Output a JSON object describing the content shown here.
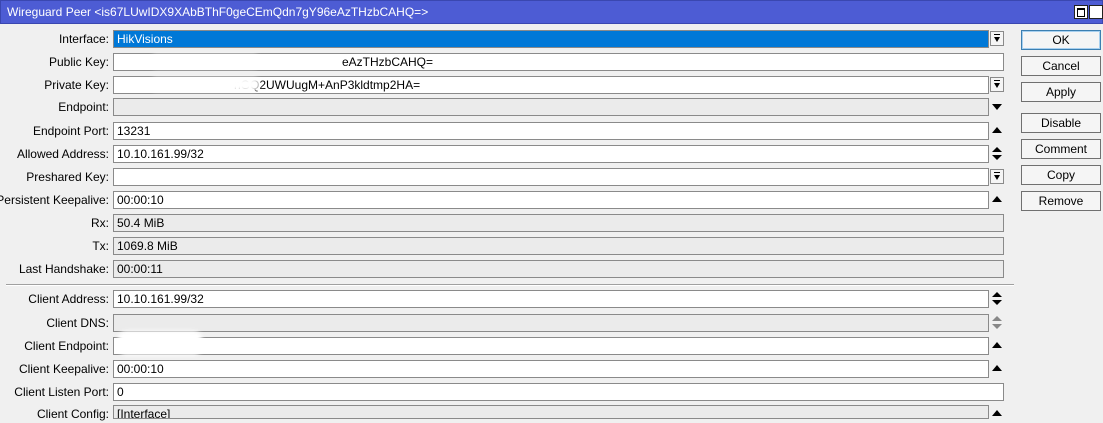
{
  "window": {
    "title": "Wireguard Peer <is67LUwIDX9XAbBThF0geCEmQdn7gY96eAzTHzbCAHQ=>"
  },
  "fields": {
    "interface": {
      "label": "Interface:",
      "value": "HikVisions"
    },
    "public_key": {
      "label": "Public Key:",
      "value": "eAzTHzbCAHQ="
    },
    "private_key": {
      "label": "Private Key:",
      "value": "nGQ2UWUugM+AnP3kldtmp2HA="
    },
    "endpoint": {
      "label": "Endpoint:",
      "value": ""
    },
    "endpoint_port": {
      "label": "Endpoint Port:",
      "value": "13231"
    },
    "allowed_address": {
      "label": "Allowed Address:",
      "value": "10.10.161.99/32"
    },
    "preshared_key": {
      "label": "Preshared Key:",
      "value": ""
    },
    "persistent_keepalive": {
      "label": "Persistent Keepalive:",
      "value": "00:00:10"
    },
    "rx": {
      "label": "Rx:",
      "value": "50.4 MiB"
    },
    "tx": {
      "label": "Tx:",
      "value": "1069.8 MiB"
    },
    "last_handshake": {
      "label": "Last Handshake:",
      "value": "00:00:11"
    },
    "client_address": {
      "label": "Client Address:",
      "value": "10.10.161.99/32"
    },
    "client_dns": {
      "label": "Client DNS:",
      "value": ""
    },
    "client_endpoint": {
      "label": "Client Endpoint:",
      "value": ""
    },
    "client_keepalive": {
      "label": "Client Keepalive:",
      "value": "00:00:10"
    },
    "client_listen_port": {
      "label": "Client Listen Port:",
      "value": "0"
    },
    "client_config": {
      "label": "Client Config:",
      "value": "[Interface]"
    }
  },
  "buttons": {
    "ok": "OK",
    "cancel": "Cancel",
    "apply": "Apply",
    "disable": "Disable",
    "comment": "Comment",
    "copy": "Copy",
    "remove": "Remove"
  }
}
